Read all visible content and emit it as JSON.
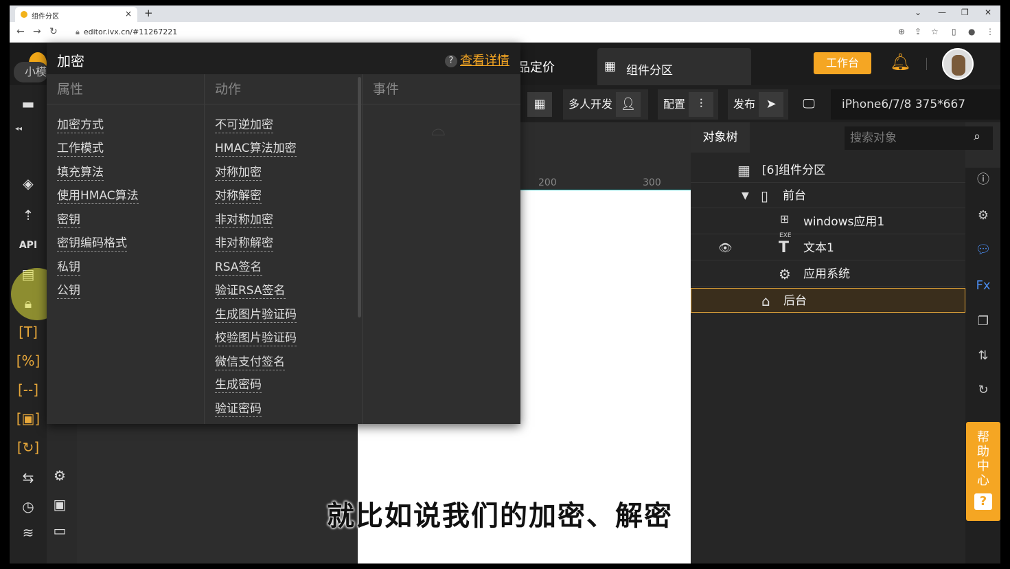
{
  "browser": {
    "tab_title": "组件分区",
    "tab_close": "×",
    "new_tab": "+",
    "url": "editor.ivx.cn/#11267221",
    "win_controls": [
      "⌄",
      "—",
      "❐",
      "✕"
    ]
  },
  "header": {
    "pricing": "品定价",
    "current_tab": "组件分区",
    "workbench": "工作台"
  },
  "leftbar": {
    "collapse": "◂◂",
    "pill_label": "小模",
    "api_label": "API"
  },
  "toolbar": {
    "multi_dev": "多人开发",
    "config": "配置",
    "publish": "发布",
    "device": "iPhone6/7/8 375*667"
  },
  "ruler": [
    "200",
    "300"
  ],
  "subtitle": "就比如说我们的加密、解密",
  "object_tree": {
    "tab": "对象树",
    "search_placeholder": "搜索对象",
    "nodes": [
      {
        "label": "[6]组件分区"
      },
      {
        "label": "前台"
      },
      {
        "label": "windows应用1",
        "badge": "EXE"
      },
      {
        "label": "文本1"
      },
      {
        "label": "应用系统"
      },
      {
        "label": "后台"
      }
    ]
  },
  "help_center": {
    "label": "帮助中心",
    "q": "?"
  },
  "popup": {
    "title": "加密",
    "help_link": "查看详情",
    "help_mark": "?",
    "columns": {
      "properties": "属性",
      "actions": "动作",
      "events": "事件"
    },
    "properties": [
      "加密方式",
      "工作模式",
      "填充算法",
      "使用HMAC算法",
      "密钥",
      "密钥编码格式",
      "私钥",
      "公钥"
    ],
    "actions": [
      "不可逆加密",
      "HMAC算法加密",
      "对称加密",
      "对称解密",
      "非对称加密",
      "非对称解密",
      "RSA签名",
      "验证RSA签名",
      "生成图片验证码",
      "校验图片验证码",
      "微信支付签名",
      "生成密码",
      "验证密码"
    ]
  }
}
